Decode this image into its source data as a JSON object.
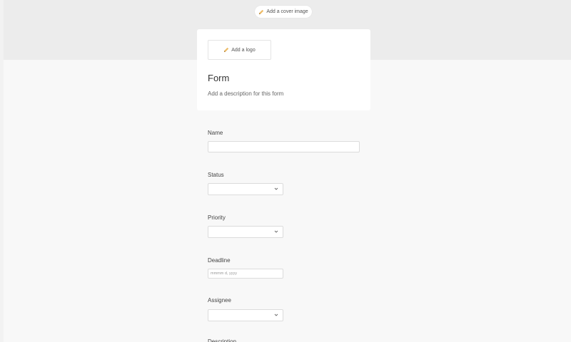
{
  "cover": {
    "add_cover_label": "Add a cover image"
  },
  "header_card": {
    "add_logo_label": "Add a logo",
    "title": "Form",
    "description": "Add a description for this form"
  },
  "fields": {
    "name": {
      "label": "Name",
      "value": ""
    },
    "status": {
      "label": "Status",
      "value": ""
    },
    "priority": {
      "label": "Priority",
      "value": ""
    },
    "deadline": {
      "label": "Deadline",
      "placeholder": "mmmm d, yyyy"
    },
    "assignee": {
      "label": "Assignee",
      "value": ""
    },
    "next_partial": {
      "label": "Description"
    }
  },
  "colors": {
    "cover_bg": "#ececec",
    "page_bg": "#f8f8f8",
    "accent": "#e8a33b"
  },
  "icons": {
    "cover_button": "pencil-icon",
    "logo_button": "pencil-icon",
    "select_caret": "chevron-down-icon"
  }
}
